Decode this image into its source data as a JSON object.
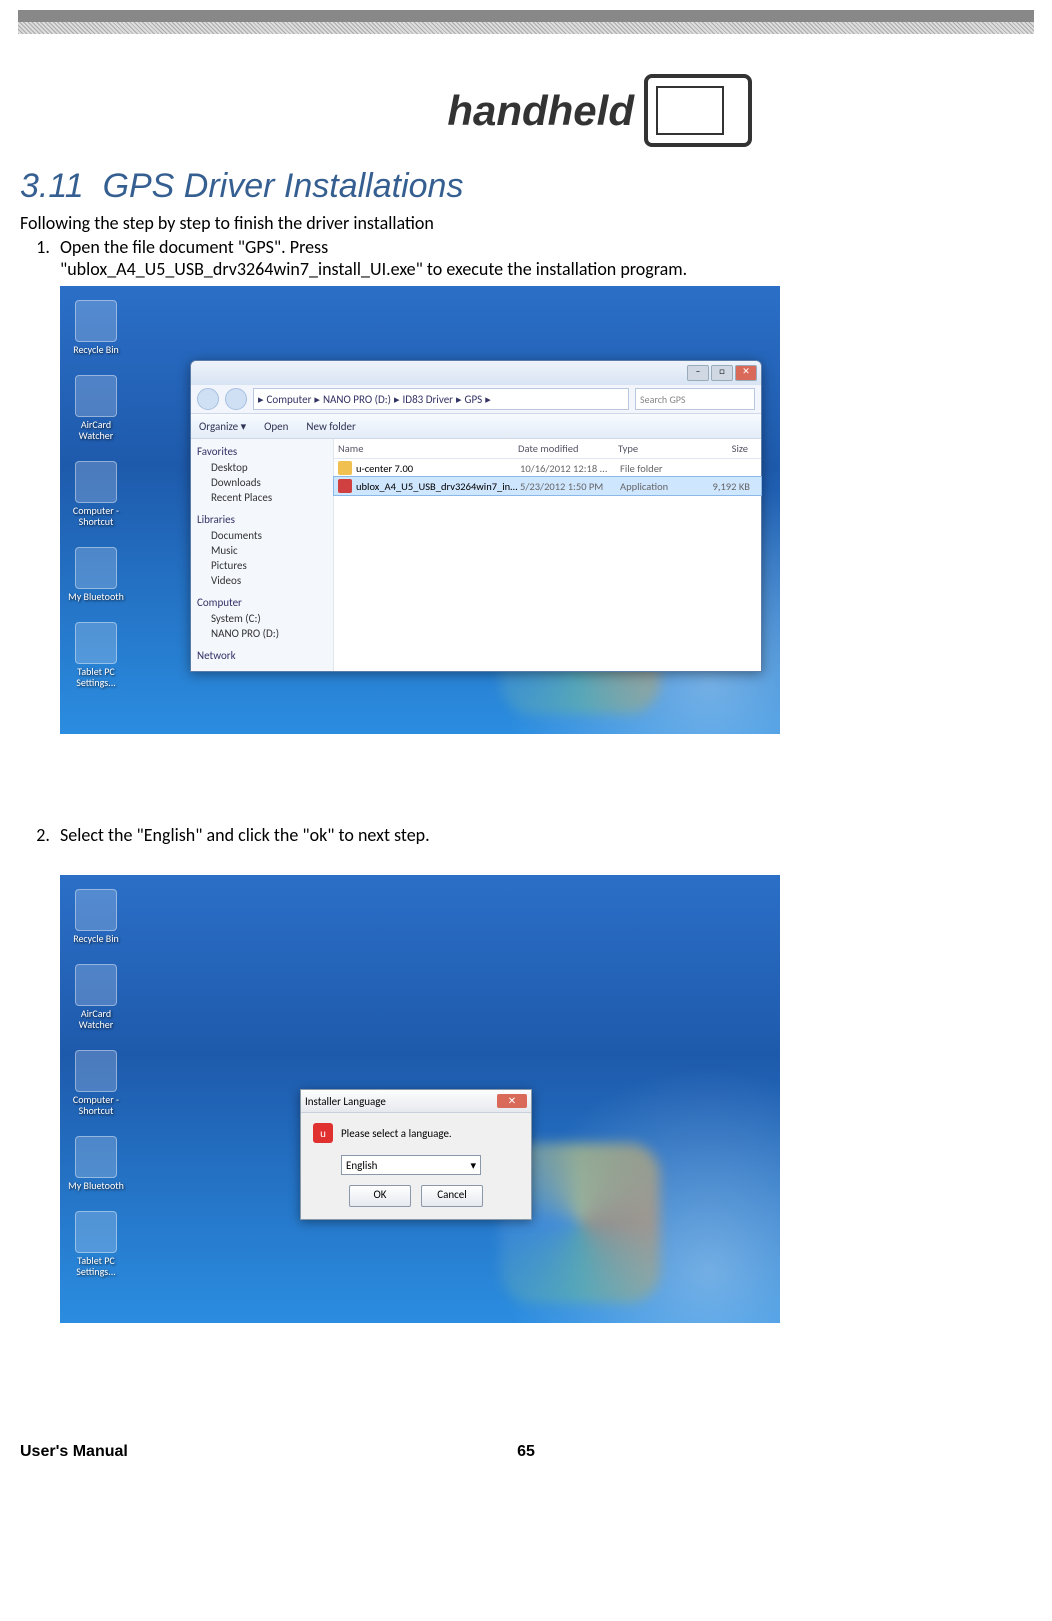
{
  "brand": {
    "name": "handheld"
  },
  "section": {
    "number": "3.11",
    "title": "GPS Driver Installations"
  },
  "intro": "Following the step by step to finish the driver installation",
  "step1": {
    "number": "1.",
    "line1": "Open the file document \"GPS\". Press",
    "line2": "\"ublox_A4_U5_USB_drv3264win7_install_UI.exe\" to execute the installation program."
  },
  "step2": {
    "number": "2.",
    "text": "Select the \"English\" and click the \"ok\" to next step."
  },
  "desktop_icons": [
    {
      "label": "Recycle Bin"
    },
    {
      "label": "AirCard Watcher"
    },
    {
      "label": "Computer - Shortcut"
    },
    {
      "label": "My Bluetooth"
    },
    {
      "label": "Tablet PC Settings..."
    }
  ],
  "explorer": {
    "breadcrumb": [
      "Computer",
      "NANO PRO (D:)",
      "ID83 Driver",
      "GPS"
    ],
    "search_placeholder": "Search GPS",
    "toolbar": {
      "organize": "Organize ▾",
      "open": "Open",
      "newfolder": "New folder"
    },
    "columns": {
      "name": "Name",
      "date": "Date modified",
      "type": "Type",
      "size": "Size"
    },
    "rows": [
      {
        "name": "u-center 7.00",
        "date": "10/16/2012 12:18 ...",
        "type": "File folder",
        "size": ""
      },
      {
        "name": "ublox_A4_U5_USB_drv3264win7_install...",
        "date": "5/23/2012 1:50 PM",
        "type": "Application",
        "size": "9,192 KB"
      }
    ],
    "sidebar": {
      "favorites": {
        "title": "Favorites",
        "items": [
          "Desktop",
          "Downloads",
          "Recent Places"
        ]
      },
      "libraries": {
        "title": "Libraries",
        "items": [
          "Documents",
          "Music",
          "Pictures",
          "Videos"
        ]
      },
      "computer": {
        "title": "Computer",
        "items": [
          "System (C:)",
          "NANO PRO (D:)"
        ]
      },
      "network": {
        "title": "Network"
      }
    }
  },
  "lang_dialog": {
    "title": "Installer Language",
    "prompt": "Please select a language.",
    "selected": "English",
    "ok": "OK",
    "cancel": "Cancel"
  },
  "footer": {
    "left": "User's Manual",
    "page": "65"
  }
}
